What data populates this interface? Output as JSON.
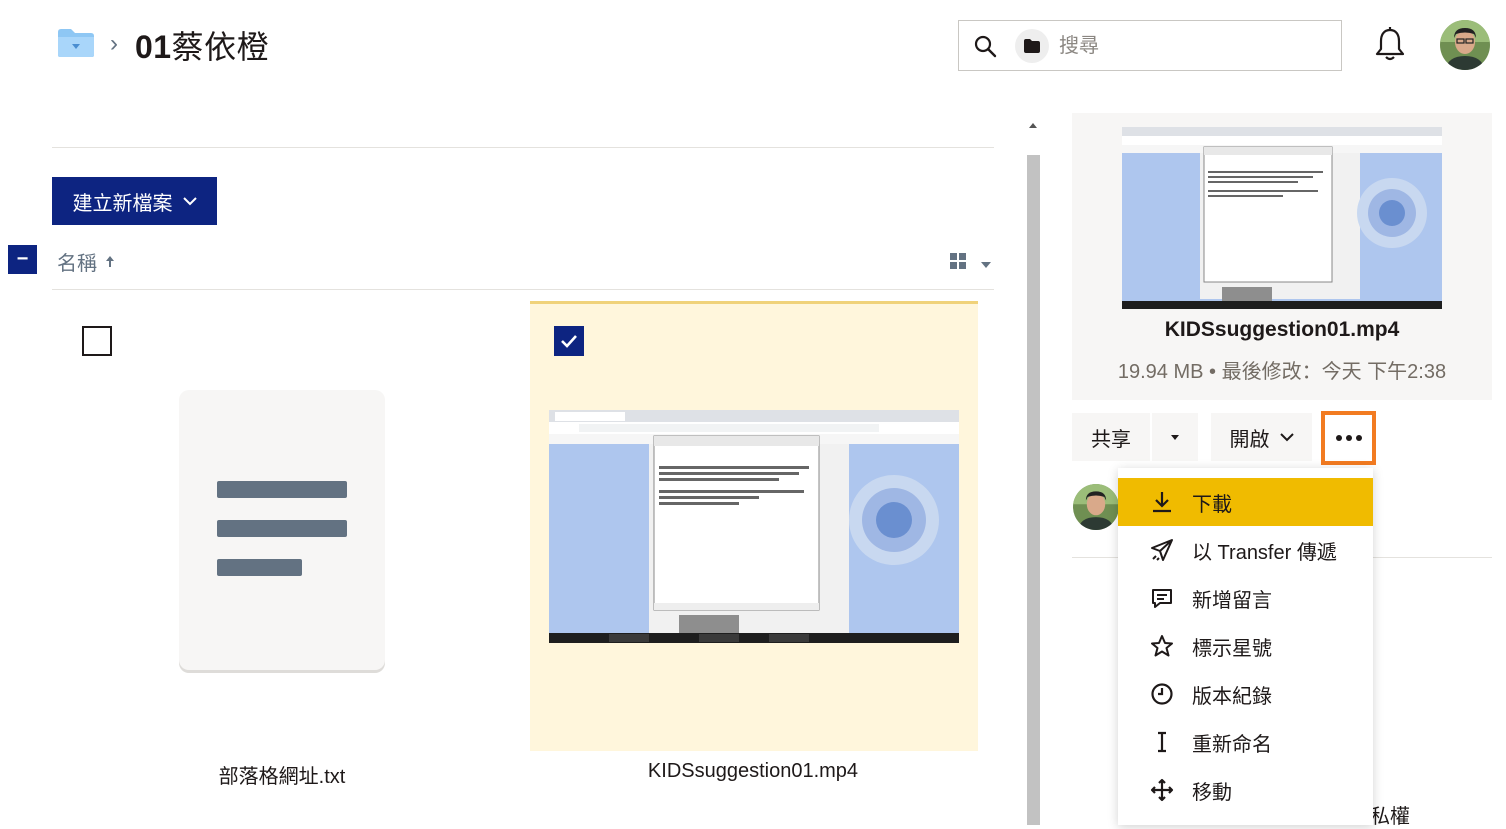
{
  "breadcrumb": {
    "separator": "›",
    "title_bold": "01",
    "title_rest": "蔡依橙"
  },
  "search": {
    "placeholder": "搜尋"
  },
  "toolbar": {
    "create_label": "建立新檔案"
  },
  "list_header": {
    "select_all_symbol": "−",
    "name_column": "名稱"
  },
  "files": [
    {
      "name": "部落格網址.txt",
      "selected": false
    },
    {
      "name": "KIDSsuggestion01.mp4",
      "selected": true
    }
  ],
  "side_panel": {
    "file_title": "KIDSsuggestion01.mp4",
    "size": "19.94 MB",
    "meta_sep": "•",
    "modified": "最後修改：今天 下午2:38",
    "share_label": "共享",
    "open_label": "開啟",
    "privacy_partial": "私權"
  },
  "menu": {
    "items": [
      {
        "label": "下載",
        "icon": "download-icon"
      },
      {
        "label": "以 Transfer 傳遞",
        "icon": "send-icon"
      },
      {
        "label": "新增留言",
        "icon": "comment-icon"
      },
      {
        "label": "標示星號",
        "icon": "star-icon"
      },
      {
        "label": "版本紀錄",
        "icon": "clock-icon"
      },
      {
        "label": "重新命名",
        "icon": "text-cursor-icon"
      },
      {
        "label": "移動",
        "icon": "move-icon"
      }
    ]
  },
  "colors": {
    "primary_navy": "#0d2481",
    "highlight_orange": "#f27b21",
    "menu_active": "#f0bb00",
    "selected_tile": "#fff6dc"
  }
}
